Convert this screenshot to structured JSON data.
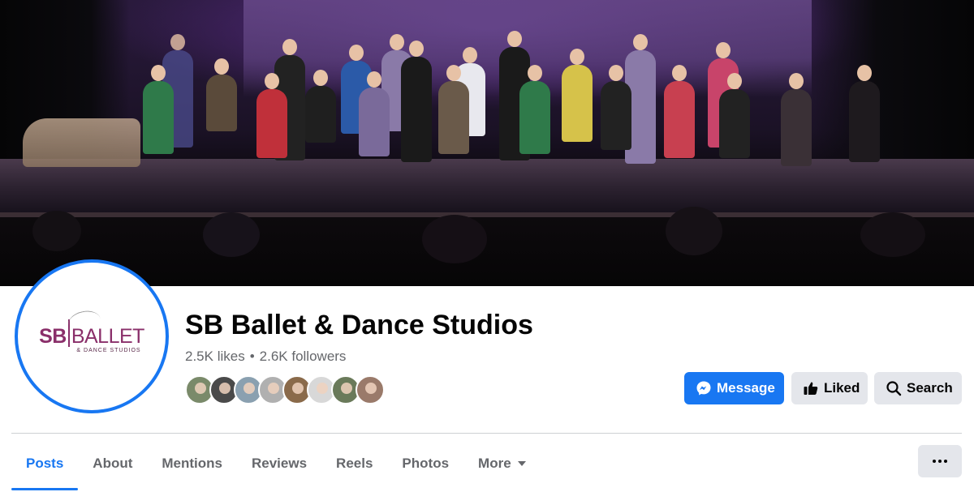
{
  "page": {
    "name": "SB Ballet & Dance Studios",
    "likes": "2.5K likes",
    "separator": "•",
    "followers": "2.6K followers"
  },
  "avatar": {
    "logo_sb": "SB",
    "logo_ballet": "BALLET",
    "logo_sub": "& DANCE STUDIOS"
  },
  "friends": {
    "count_shown": 8,
    "colors": [
      "#7a8a6a",
      "#4a4a4a",
      "#8aa0b0",
      "#b0b0b0",
      "#8a6a4a",
      "#d8d8d8",
      "#6a7a5a",
      "#9a7a6a"
    ]
  },
  "actions": {
    "message_label": "Message",
    "liked_label": "Liked",
    "search_label": "Search"
  },
  "tabs": [
    {
      "label": "Posts",
      "active": true
    },
    {
      "label": "About",
      "active": false
    },
    {
      "label": "Mentions",
      "active": false
    },
    {
      "label": "Reviews",
      "active": false
    },
    {
      "label": "Reels",
      "active": false
    },
    {
      "label": "Photos",
      "active": false
    },
    {
      "label": "More",
      "active": false
    }
  ],
  "colors": {
    "accent": "#1877f2",
    "button_gray": "#e4e6eb",
    "secondary_text": "#65676b",
    "logo_purple": "#8a2f6a"
  }
}
